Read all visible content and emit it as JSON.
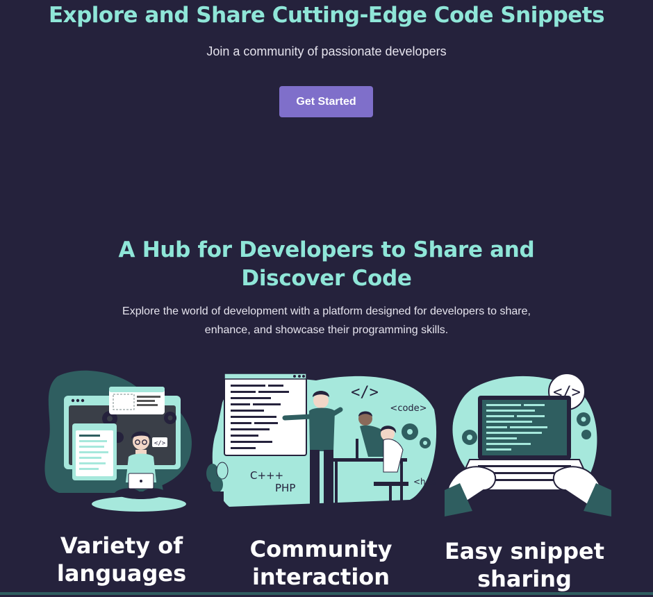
{
  "hero": {
    "title": "Explore and Share Cutting-Edge Code Snippets",
    "subtitle": "Join a community of passionate developers",
    "cta_label": "Get Started"
  },
  "section": {
    "title": "A Hub for Developers to Share and Discover Code",
    "description": "Explore the world of development with a platform designed for developers to share, enhance, and showcase their programming skills."
  },
  "features": [
    {
      "title": "Variety of languages",
      "illustration": "developer-laptop-browser-illustration"
    },
    {
      "title": "Community interaction",
      "illustration": "team-coding-whiteboard-illustration",
      "labels": [
        "</>",
        "<code>",
        "C+++",
        "PHP",
        "<hea"
      ]
    },
    {
      "title": "Easy snippet sharing",
      "illustration": "typing-laptop-code-illustration",
      "labels": [
        "</>"
      ]
    }
  ],
  "colors": {
    "background": "#25223c",
    "accent": "#8fe6d8",
    "button": "#7f6fca",
    "illustration_teal": "#a6e8dc",
    "illustration_dark": "#2f5e60"
  }
}
